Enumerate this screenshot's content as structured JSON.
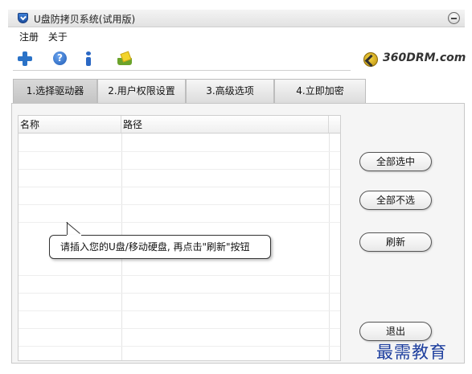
{
  "window": {
    "title": "U盘防拷贝系统(试用版)"
  },
  "menu": {
    "items": [
      "注册",
      "关于"
    ]
  },
  "toolbar": {
    "icons": [
      "add-icon",
      "help-icon",
      "info-icon",
      "tray-icon"
    ],
    "help_glyph": "?",
    "brand": "360DRM.com"
  },
  "tabs": [
    {
      "label": "1.选择驱动器",
      "active": true
    },
    {
      "label": "2.用户权限设置",
      "active": false
    },
    {
      "label": "3.高级选项",
      "active": false
    },
    {
      "label": "4.立即加密",
      "active": false
    }
  ],
  "table": {
    "columns": [
      "名称",
      "路径"
    ],
    "rows": []
  },
  "tooltip": {
    "text": "请插入您的U盘/移动硬盘, 再点击\"刷新\"按钮"
  },
  "buttons": {
    "select_all": "全部选中",
    "select_none": "全部不选",
    "refresh": "刷新",
    "exit": "退出"
  },
  "watermark": "最需教育",
  "colors": {
    "accent_blue": "#2a72c7",
    "watermark": "#1e3f9e"
  }
}
